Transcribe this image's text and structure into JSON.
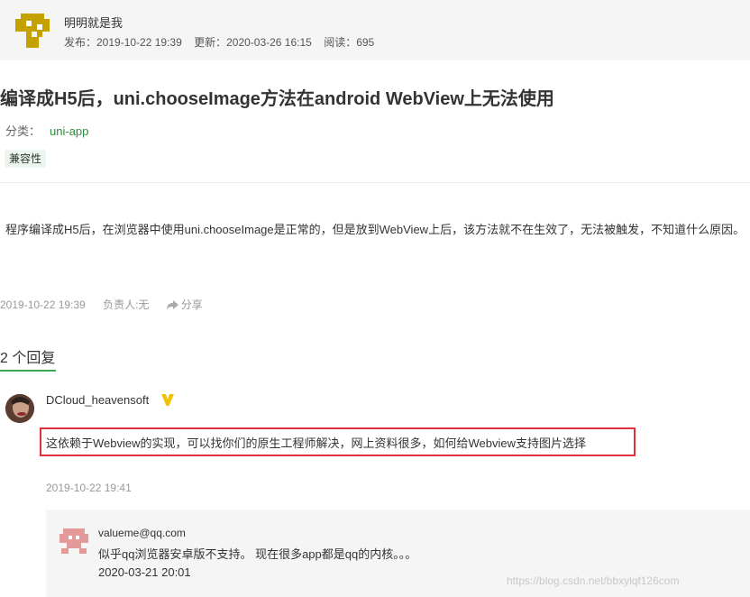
{
  "author": {
    "name": "明明就是我",
    "published": "发布：2019-10-22 19:39",
    "updated": "更新：2020-03-26 16:15",
    "views": "阅读：695",
    "avatar_color": "#c5a100"
  },
  "question": {
    "title": "编译成H5后，uni.chooseImage方法在android WebView上无法使用",
    "category_label": "分类：",
    "category": "uni-app",
    "tag": "兼容性",
    "body": "程序编译成H5后，在浏览器中使用uni.chooseImage是正常的，但是放到WebView上后，该方法就不在生效了，无法被触发，不知道什么原因。",
    "date": "2019-10-22 19:39",
    "owner": "负责人:无",
    "share": "分享"
  },
  "replies": {
    "heading": "2 个回复",
    "accent": "#3cab4f",
    "items": [
      {
        "name": "DCloud_heavensoft",
        "badge_icon": "v-badge-icon",
        "text": "这依赖于Webview的实现，可以找你们的原生工程师解决，网上资料很多，如何给Webview支持图片选择",
        "time": "2019-10-22 19:41",
        "highlight_color": "#e0323a"
      }
    ],
    "sub": {
      "name": "valueme@qq.com",
      "text": "似乎qq浏览器安卓版不支持。 现在很多app都是qq的内核。。。",
      "time": "2020-03-21 20:01",
      "avatar_color": "#e59a9a"
    }
  },
  "watermark": "https://blog.csdn.net/bbxylqf126com"
}
